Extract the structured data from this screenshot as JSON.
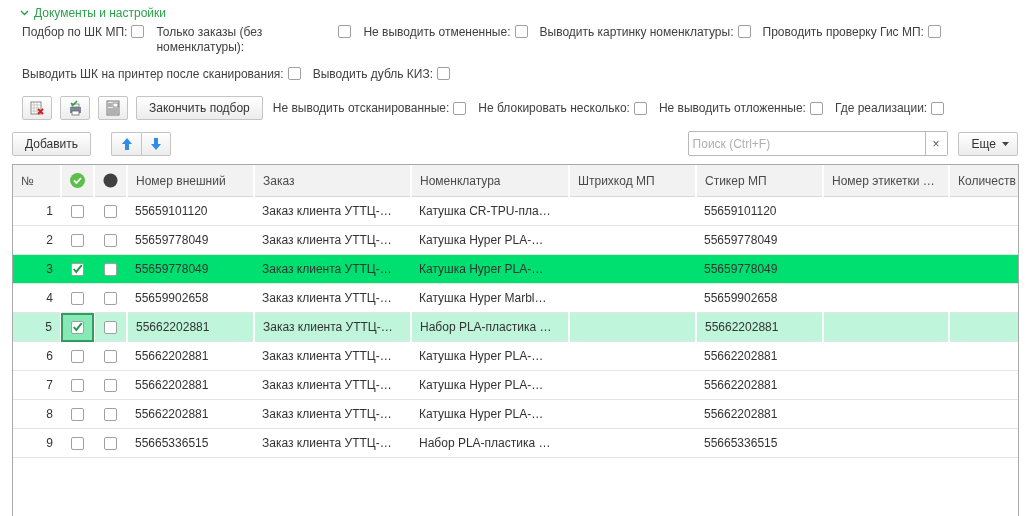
{
  "section": {
    "title": "Документы и настройки",
    "expanded": true
  },
  "settings_lines": [
    [
      {
        "label": "Подбор по ШК МП:",
        "checked": false
      },
      {
        "label": "Только заказы (без номенклатуры):",
        "checked": false,
        "wrap": true
      },
      {
        "label": "Не выводить отмененные:",
        "checked": false
      },
      {
        "label": "Выводить картинку номенклатуры:",
        "checked": false
      },
      {
        "label": "Проводить проверку Гис МП:",
        "checked": false
      }
    ],
    [
      {
        "label": "Выводить ШК на принтер после сканирования:",
        "checked": false
      },
      {
        "label": "Выводить дубль КИЗ:",
        "checked": false
      }
    ]
  ],
  "toolbar": {
    "finish_button": "Закончить подбор",
    "options": [
      {
        "label": "Не выводить отсканированные:",
        "checked": false
      },
      {
        "label": "Не блокировать несколько:",
        "checked": false
      },
      {
        "label": "Не выводить отложенные:",
        "checked": false
      },
      {
        "label": "Где реализации:",
        "checked": false
      }
    ]
  },
  "commands": {
    "add_button": "Добавить",
    "search": {
      "placeholder": "Поиск (Ctrl+F)"
    },
    "clear_button": "×",
    "more_button": "Еще"
  },
  "table": {
    "columns": [
      {
        "kind": "text",
        "label": "№"
      },
      {
        "kind": "check-icon"
      },
      {
        "kind": "dot-icon"
      },
      {
        "kind": "text",
        "label": "Номер внешний"
      },
      {
        "kind": "text",
        "label": "Заказ"
      },
      {
        "kind": "text",
        "label": "Номенклатура"
      },
      {
        "kind": "text",
        "label": "Штрихкод МП"
      },
      {
        "kind": "text",
        "label": "Стикер МП"
      },
      {
        "kind": "text",
        "label": "Номер этикетки …"
      },
      {
        "kind": "text",
        "label": "Количеств"
      }
    ],
    "rows": [
      {
        "number": "1",
        "checked": false,
        "marked": false,
        "external_number": "55659101120",
        "order": "Заказ клиента УТТЦ-…",
        "item": "Катушка CR-TPU-пла…",
        "sticker": "55659101120",
        "highlighted": false,
        "selected": false
      },
      {
        "number": "2",
        "checked": false,
        "marked": false,
        "external_number": "55659778049",
        "order": "Заказ клиента УТТЦ-…",
        "item": "Катушка Hyper PLA-…",
        "sticker": "55659778049",
        "highlighted": false,
        "selected": false
      },
      {
        "number": "3",
        "checked": true,
        "marked": false,
        "external_number": "55659778049",
        "order": "Заказ клиента УТТЦ-…",
        "item": "Катушка Hyper PLA-…",
        "sticker": "55659778049",
        "highlighted": true,
        "selected": false
      },
      {
        "number": "4",
        "checked": false,
        "marked": false,
        "external_number": "55659902658",
        "order": "Заказ клиента УТТЦ-…",
        "item": "Катушка Hyper Marbl…",
        "sticker": "55659902658",
        "highlighted": false,
        "selected": false
      },
      {
        "number": "5",
        "checked": true,
        "marked": false,
        "external_number": "55662202881",
        "order": "Заказ клиента УТТЦ-…",
        "item": "Набор PLA-пластика …",
        "sticker": "55662202881",
        "highlighted": false,
        "selected": true
      },
      {
        "number": "6",
        "checked": false,
        "marked": false,
        "external_number": "55662202881",
        "order": "Заказ клиента УТТЦ-…",
        "item": "Катушка Hyper PLA-…",
        "sticker": "55662202881",
        "highlighted": false,
        "selected": false
      },
      {
        "number": "7",
        "checked": false,
        "marked": false,
        "external_number": "55662202881",
        "order": "Заказ клиента УТТЦ-…",
        "item": "Катушка Hyper PLA-…",
        "sticker": "55662202881",
        "highlighted": false,
        "selected": false
      },
      {
        "number": "8",
        "checked": false,
        "marked": false,
        "external_number": "55662202881",
        "order": "Заказ клиента УТТЦ-…",
        "item": "Катушка Hyper PLA-…",
        "sticker": "55662202881",
        "highlighted": false,
        "selected": false
      },
      {
        "number": "9",
        "checked": false,
        "marked": false,
        "external_number": "55665336515",
        "order": "Заказ клиента УТТЦ-…",
        "item": "Набор PLA-пластика …",
        "sticker": "55665336515",
        "highlighted": false,
        "selected": false
      }
    ]
  }
}
